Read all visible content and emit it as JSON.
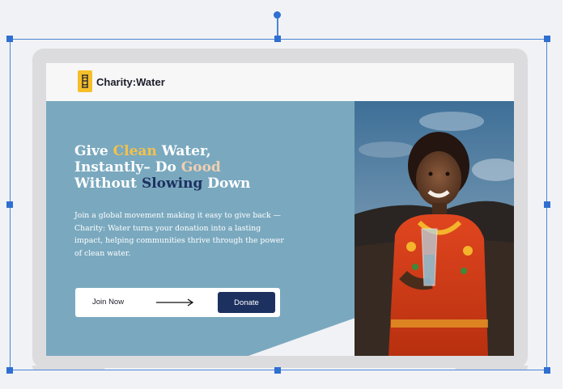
{
  "brand": {
    "name": "Charity:Water",
    "accent": "#f5bf2a",
    "navy": "#1d3160",
    "hero_bg": "#7aa9bf"
  },
  "hero": {
    "headline": {
      "part1": " Give ",
      "clean": "Clean",
      "part2": " Water,",
      "part3": "Instantly– Do ",
      "good": "Good",
      "part4": "Without ",
      "slowing": "Slowing",
      "part5": " Down"
    },
    "body": "Join a global movement making it easy to give back — Charity: Water turns your donation into a lasting impact, helping communities thrive through the power of clean water.",
    "join_label": "Join Now",
    "donate_label": "Donate"
  },
  "icons": {
    "logo": "jerrycan-icon",
    "arrow": "arrow-right-icon"
  }
}
